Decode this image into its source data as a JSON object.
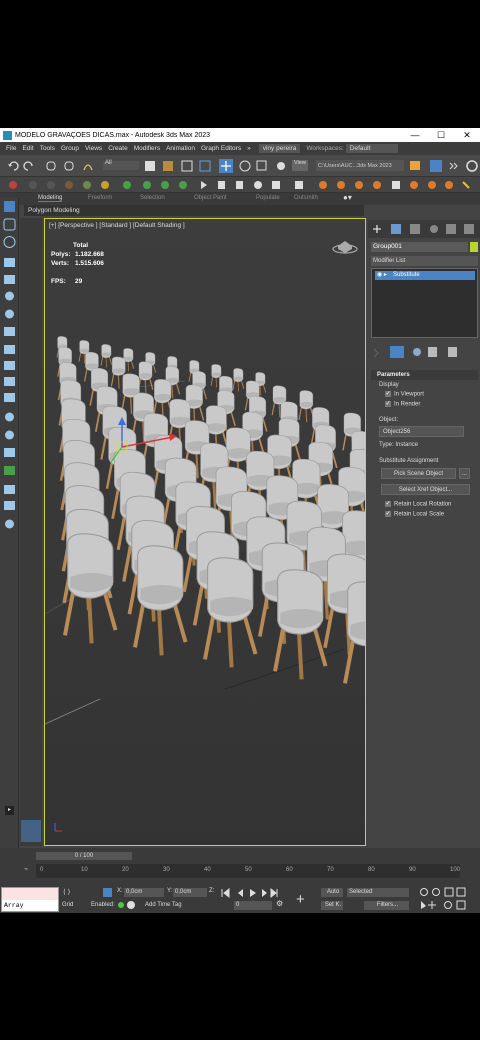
{
  "window": {
    "title": "MODELO GRAVAÇOES DICAS.max - Autodesk 3ds Max 2023",
    "controls": [
      "—",
      "☐",
      "✕"
    ]
  },
  "menubar": {
    "items": [
      "File",
      "Edit",
      "Tools",
      "Group",
      "Views",
      "Create",
      "Modifiers",
      "Animation",
      "Graph Editors",
      "»"
    ],
    "user": "viny pereira",
    "workspaces_label": "Workspaces:",
    "workspace": "Default"
  },
  "toolbar": {
    "selection_filter": "All",
    "view_label": "View",
    "path": "C:\\Users\\AUC...3ds Max 2023"
  },
  "ribbon": {
    "tabs": [
      "Modeling",
      "Freeform",
      "Selection",
      "Object Paint",
      "Populate",
      "Outsmith"
    ],
    "sub_label": "Polygon Modeling"
  },
  "viewport": {
    "label": "[+] [Perspective ] [Standard ] [Default Shading ]",
    "stats_total": "Total",
    "polys_label": "Polys:",
    "polys_value": "1.182.668",
    "verts_label": "Verts:",
    "verts_value": "1.515.606",
    "fps_label": "FPS:",
    "fps_value": "29"
  },
  "command_panel": {
    "object_name": "Group001",
    "modifier_list": "Modifier List",
    "stack_item": "Substitute",
    "params_header": "Parameters",
    "display_label": "Display",
    "in_viewport": "In Viewport",
    "in_render": "In Render",
    "object_label": "Object:",
    "object_value": "Object256",
    "type_label": "Type: Instance",
    "assign_header": "Substitute Assignment",
    "pick_button": "Pick Scene Object",
    "pick_more": "...",
    "select_xref": "Select Xref Object...",
    "retain_rotation": "Retain Local Rotation",
    "retain_scale": "Retain Local Scale"
  },
  "timeline": {
    "frame": "0 / 100",
    "ticks": [
      "0",
      "10",
      "20",
      "30",
      "40",
      "50",
      "60",
      "70",
      "80",
      "90",
      "100"
    ]
  },
  "statusbar": {
    "maxscript": "Array modifier",
    "x_label": "X:",
    "x_value": "0,0cm",
    "y_label": "Y:",
    "y_value": "0,0cm",
    "z_label": "Z:",
    "enabled": "Enabled:",
    "add_time_tag": "Add Time Tag",
    "auto": "Auto",
    "selected": "Selected",
    "set_k": "Set K.",
    "filters": "Filters...",
    "frame_field": "0"
  },
  "colors": {
    "accent_logo": "#f2e331",
    "viewport_border": "#c9d33a",
    "selection_blue": "#4a84c5"
  }
}
